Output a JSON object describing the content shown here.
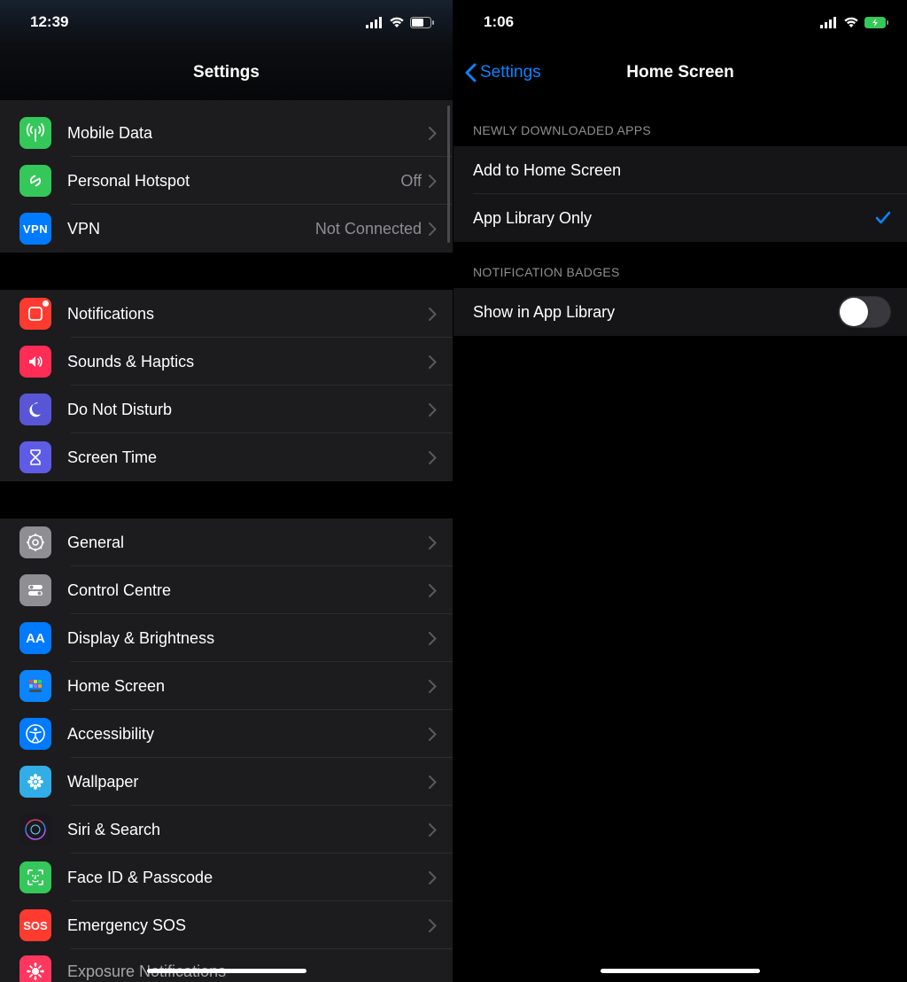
{
  "left": {
    "status": {
      "time": "12:39"
    },
    "title": "Settings",
    "group1": [
      {
        "label": "Mobile Data",
        "value": "",
        "icon": "antenna",
        "color": "bg-green"
      },
      {
        "label": "Personal Hotspot",
        "value": "Off",
        "icon": "link",
        "color": "bg-green"
      },
      {
        "label": "VPN",
        "value": "Not Connected",
        "icon": "vpn",
        "color": "bg-blue"
      }
    ],
    "group2": [
      {
        "label": "Notifications",
        "icon": "notifications",
        "color": "bg-red"
      },
      {
        "label": "Sounds & Haptics",
        "icon": "sounds",
        "color": "bg-pink"
      },
      {
        "label": "Do Not Disturb",
        "icon": "moon",
        "color": "bg-purple"
      },
      {
        "label": "Screen Time",
        "icon": "hourglass",
        "color": "bg-indigo"
      }
    ],
    "group3": [
      {
        "label": "General",
        "icon": "gear",
        "color": "bg-gray"
      },
      {
        "label": "Control Centre",
        "icon": "switches",
        "color": "bg-gray"
      },
      {
        "label": "Display & Brightness",
        "icon": "aa",
        "color": "bg-blue"
      },
      {
        "label": "Home Screen",
        "icon": "grid",
        "color": "bg-deepblue"
      },
      {
        "label": "Accessibility",
        "icon": "accessibility",
        "color": "bg-blue"
      },
      {
        "label": "Wallpaper",
        "icon": "flower",
        "color": "bg-cyan"
      },
      {
        "label": "Siri & Search",
        "icon": "siri",
        "color": "bg-siri"
      },
      {
        "label": "Face ID & Passcode",
        "icon": "faceid",
        "color": "bg-green"
      },
      {
        "label": "Emergency SOS",
        "icon": "sos",
        "color": "bg-redsos"
      },
      {
        "label": "Exposure Notifications",
        "icon": "exposure",
        "color": "bg-magenta"
      }
    ]
  },
  "right": {
    "status": {
      "time": "1:06"
    },
    "back": "Settings",
    "title": "Home Screen",
    "section1_header": "Newly Downloaded Apps",
    "section1": [
      {
        "label": "Add to Home Screen",
        "checked": false
      },
      {
        "label": "App Library Only",
        "checked": true
      }
    ],
    "section2_header": "Notification Badges",
    "section2": [
      {
        "label": "Show in App Library",
        "toggle": false
      }
    ]
  }
}
